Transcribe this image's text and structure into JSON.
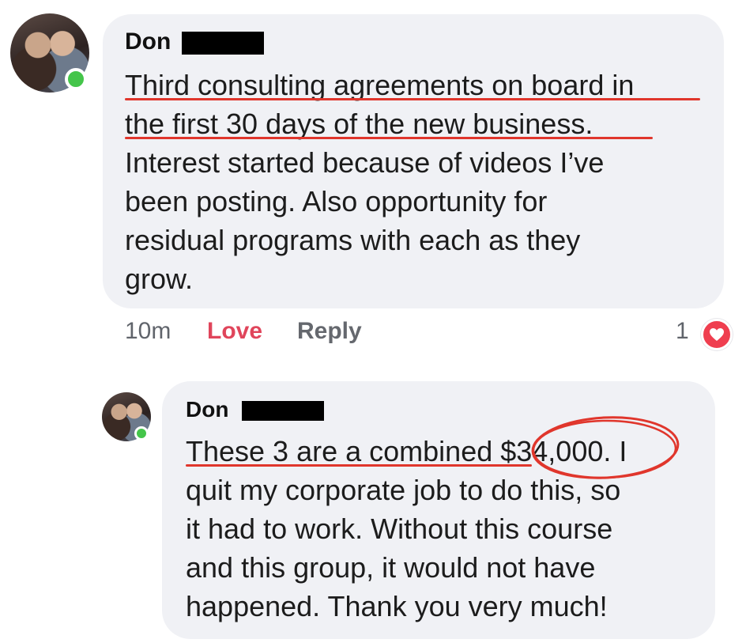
{
  "comment": {
    "author": "Don",
    "lines": [
      "Third consulting agreements on board in",
      "the first 30 days of the new business.",
      "Interest started because of videos I’ve",
      "been posting.  Also opportunity for",
      "residual programs with each as they",
      "grow."
    ],
    "time": "10m",
    "love_label": "Love",
    "reply_label": "Reply",
    "reaction_count": "1",
    "reaction_icon": "heart-icon"
  },
  "reply": {
    "author": "Don",
    "lines": [
      "These 3 are a combined $34,000. I",
      "quit my corporate job to do this, so",
      "it had to work.  Without this course",
      "and this group, it would not have",
      "happened.  Thank you very much!"
    ]
  },
  "colors": {
    "bubble": "#f0f1f5",
    "annotation_red": "#e0362c",
    "love": "#e0455b",
    "online": "#44c54a",
    "heart": "#ef3e4f"
  }
}
